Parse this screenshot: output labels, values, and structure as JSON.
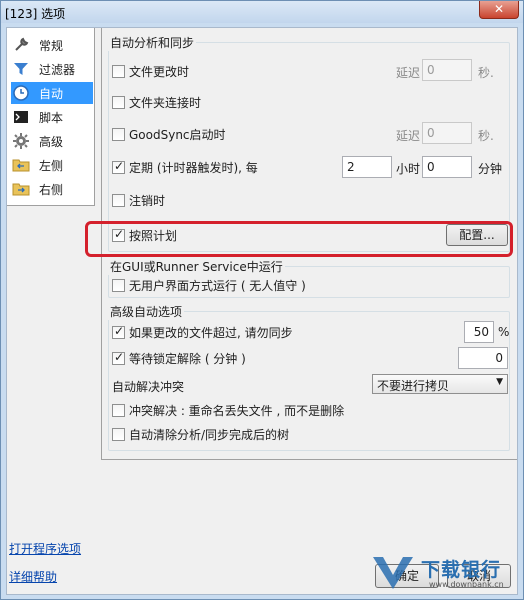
{
  "window": {
    "title": "[123] 选项",
    "close_glyph": "✕"
  },
  "sidebar": {
    "items": [
      {
        "label": "常规",
        "icon": "wrench-icon"
      },
      {
        "label": "过滤器",
        "icon": "funnel-icon"
      },
      {
        "label": "自动",
        "icon": "clock-icon"
      },
      {
        "label": "脚本",
        "icon": "script-icon"
      },
      {
        "label": "高级",
        "icon": "gear-icon"
      },
      {
        "label": "左侧",
        "icon": "folder-left-icon"
      },
      {
        "label": "右侧",
        "icon": "folder-right-icon"
      }
    ],
    "active_index": 2,
    "open_program_options": "打开程序选项",
    "detailed_help": "详细帮助"
  },
  "auto_sync": {
    "title": "自动分析和同步",
    "on_file_change": {
      "label": "文件更改时",
      "checked": false,
      "delay_label": "延迟",
      "delay_value": "0",
      "unit": "秒."
    },
    "on_folder_connect": {
      "label": "文件夹连接时",
      "checked": false
    },
    "on_goodsync_start": {
      "label": "GoodSync启动时",
      "checked": false,
      "delay_label": "延迟",
      "delay_value": "0",
      "unit": "秒."
    },
    "periodic": {
      "label": "定期 (计时器触发时), 每",
      "checked": true,
      "hours_value": "2",
      "hours_unit": "小时",
      "minutes_value": "0",
      "minutes_unit": "分钟"
    },
    "on_logoff": {
      "label": "注销时",
      "checked": false
    },
    "by_schedule": {
      "label": "按照计划",
      "checked": true,
      "configure_button": "配置..."
    }
  },
  "service": {
    "title": "在GUI或Runner Service中运行",
    "unattended": {
      "label": "无用户界面方式运行 ( 无人值守 )",
      "checked": false
    }
  },
  "advanced_auto": {
    "title": "高级自动选项",
    "changed_files_over": {
      "label": "如果更改的文件超过, 请勿同步",
      "checked": true,
      "value": "50",
      "unit": "%"
    },
    "wait_lock_release": {
      "label": "等待锁定解除 ( 分钟 )",
      "checked": true,
      "value": "0"
    },
    "conflict_label": "自动解决冲突",
    "conflict_select": "不要进行拷贝",
    "conflict_rename": {
      "label": "冲突解决 : 重命名丢失文件 , 而不是删除",
      "checked": false
    },
    "auto_clear": {
      "label": "自动清除分析/同步完成后的树",
      "checked": false
    }
  },
  "footer": {
    "ok_label": "确定",
    "cancel_label": "取消"
  },
  "watermark": {
    "brand": "下载银行",
    "url": "www.downbank.cn"
  }
}
